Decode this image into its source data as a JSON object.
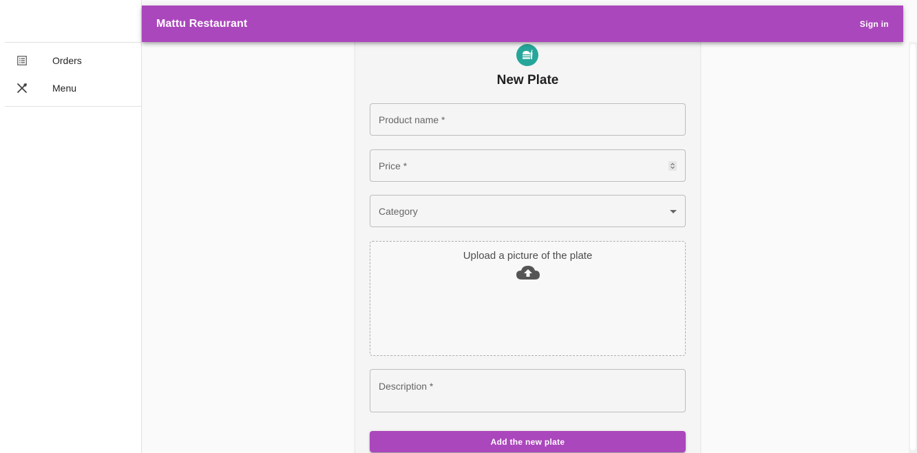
{
  "app": {
    "title": "Mattu Restaurant",
    "sign_in_label": "Sign in",
    "accent_color": "#ab47bc"
  },
  "sidebar": {
    "items": [
      {
        "label": "Orders",
        "icon": "list-alt-icon"
      },
      {
        "label": "Menu",
        "icon": "utensils-icon"
      }
    ]
  },
  "form": {
    "avatar_icon": "fastfood-icon",
    "avatar_color": "#26a69a",
    "title": "New Plate",
    "product_name_placeholder": "Product name *",
    "price_placeholder": "Price *",
    "category_placeholder": "Category",
    "upload_text": "Upload a picture of the plate",
    "upload_icon": "cloud-upload-icon",
    "description_placeholder": "Description *",
    "submit_label": "Add the new plate"
  }
}
